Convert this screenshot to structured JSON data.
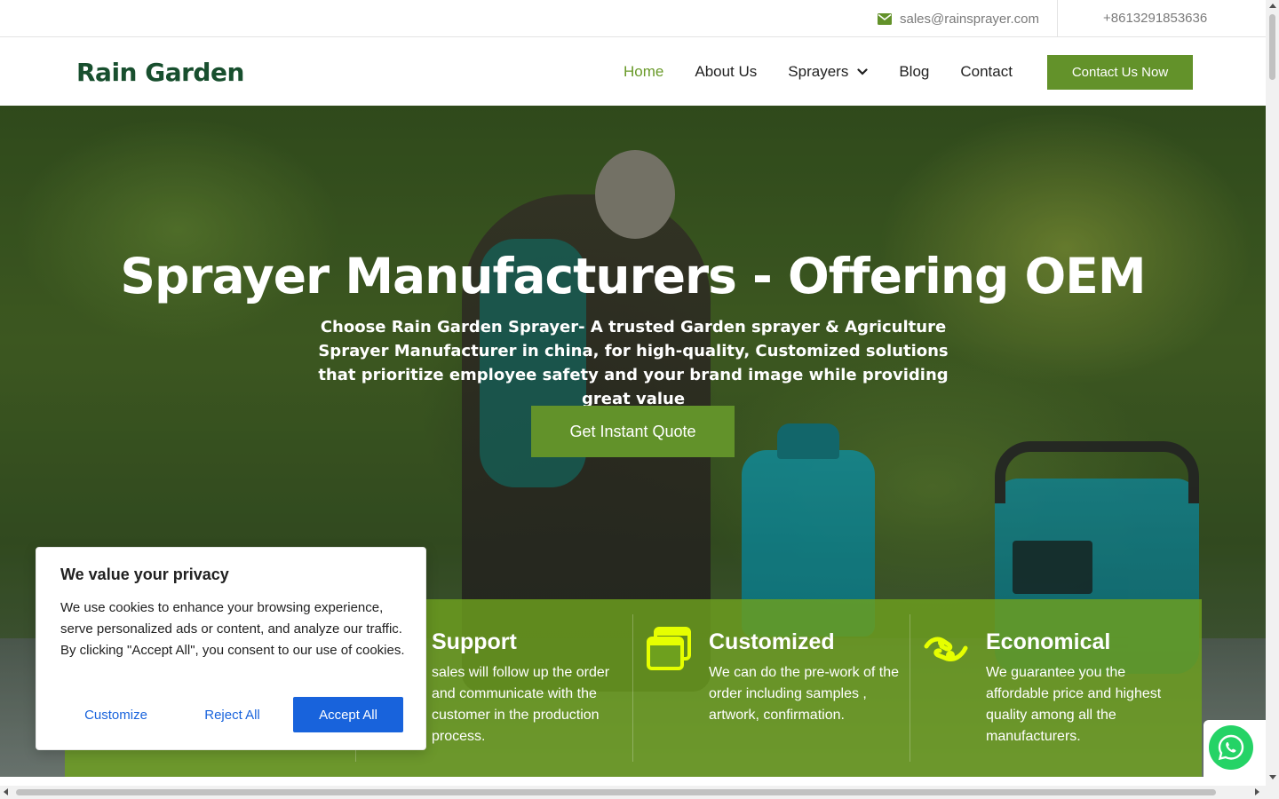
{
  "topbar": {
    "email": "sales@rainsprayer.com",
    "phone": "+8613291853636"
  },
  "navbar": {
    "logo": "Rain Garden",
    "items": [
      {
        "label": "Home",
        "active": true
      },
      {
        "label": "About Us"
      },
      {
        "label": "Sprayers",
        "has_dropdown": true
      },
      {
        "label": "Blog"
      },
      {
        "label": "Contact"
      }
    ],
    "cta": "Contact Us Now"
  },
  "hero": {
    "title": "Sprayer Manufacturers - Offering OEM",
    "subtitle": "Choose Rain Garden Sprayer- A trusted Garden sprayer & Agriculture Sprayer Manufacturer in china, for high-quality, Customized solutions that prioritize employee safety and your brand image while providing great value",
    "button": "Get Instant Quote"
  },
  "features": [
    {
      "title": "Support",
      "text": "sales will follow up the order and communicate with the customer in the production process.",
      "icon": "support-icon"
    },
    {
      "title": "Customized",
      "text": "We can do the pre-work of the order including samples , artwork, confirmation.",
      "icon": "windows-icon"
    },
    {
      "title": "Economical",
      "text": "We guarantee you the affordable price and highest quality among all the manufacturers.",
      "icon": "handshake-icon"
    }
  ],
  "cookie": {
    "title": "We value your privacy",
    "text": "We use cookies to enhance your browsing experience, serve personalized ads or content, and analyze our traffic. By clicking \"Accept All\", you consent to our use of cookies.",
    "customize": "Customize",
    "reject": "Reject All",
    "accept": "Accept All"
  },
  "colors": {
    "brand_green": "#63922a",
    "feature_band": "#6ea01e",
    "icon_yellow": "#e6ff00",
    "cookie_blue": "#1863dc",
    "whatsapp": "#25d366"
  }
}
